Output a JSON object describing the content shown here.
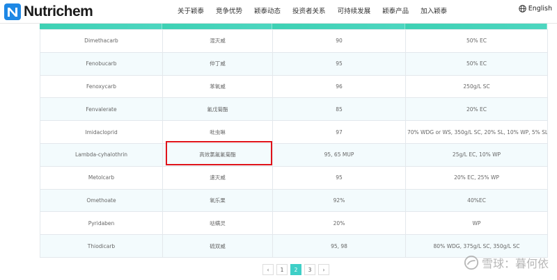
{
  "brand": {
    "name": "Nutrichem",
    "logo_letter": "N",
    "color": "#1e88e5"
  },
  "nav": {
    "items": [
      "关于颖泰",
      "竞争优势",
      "颖泰动态",
      "投资者关系",
      "可持续发展",
      "颖泰产品",
      "加入颖泰"
    ]
  },
  "lang": {
    "label": "English",
    "icon": "globe-icon"
  },
  "table": {
    "rows": [
      [
        "Dimethacarb",
        "混灭威",
        "90",
        "50% EC"
      ],
      [
        "Fenobucarb",
        "仲丁威",
        "95",
        "50% EC"
      ],
      [
        "Fenoxycarb",
        "苯氧威",
        "96",
        "250g/L SC"
      ],
      [
        "Fenvalerate",
        "氰戊菊酯",
        "85",
        "20% EC"
      ],
      [
        "Imidacloprid",
        "吡虫啉",
        "97",
        "70% WDG or WS, 350g/L SC, 20% SL, 10% WP, 5% SL"
      ],
      [
        "Lambda-cyhalothrin",
        "高效氯氟氰菊酯",
        "95, 65 MUP",
        "25g/L EC, 10% WP"
      ],
      [
        "Metolcarb",
        "速灭威",
        "95",
        "20% EC, 25% WP"
      ],
      [
        "Omethoate",
        "氧乐果",
        "92%",
        "40%EC"
      ],
      [
        "Pyridaben",
        "哒螨灵",
        "20%",
        "WP"
      ],
      [
        "Thiodicarb",
        "硫双威",
        "95, 98",
        "80% WDG, 375g/L SC, 350g/L SC"
      ]
    ]
  },
  "pagination": {
    "prev": "‹",
    "pages": [
      "1",
      "2",
      "3"
    ],
    "active": "2",
    "next": "›"
  },
  "watermark": {
    "text": "雪球：暮何依"
  },
  "colors": {
    "header_bar": "#3dd1b4",
    "active_page": "#3fcfc7",
    "highlight": "#e0131a",
    "alt_row": "#f3fbfd"
  }
}
